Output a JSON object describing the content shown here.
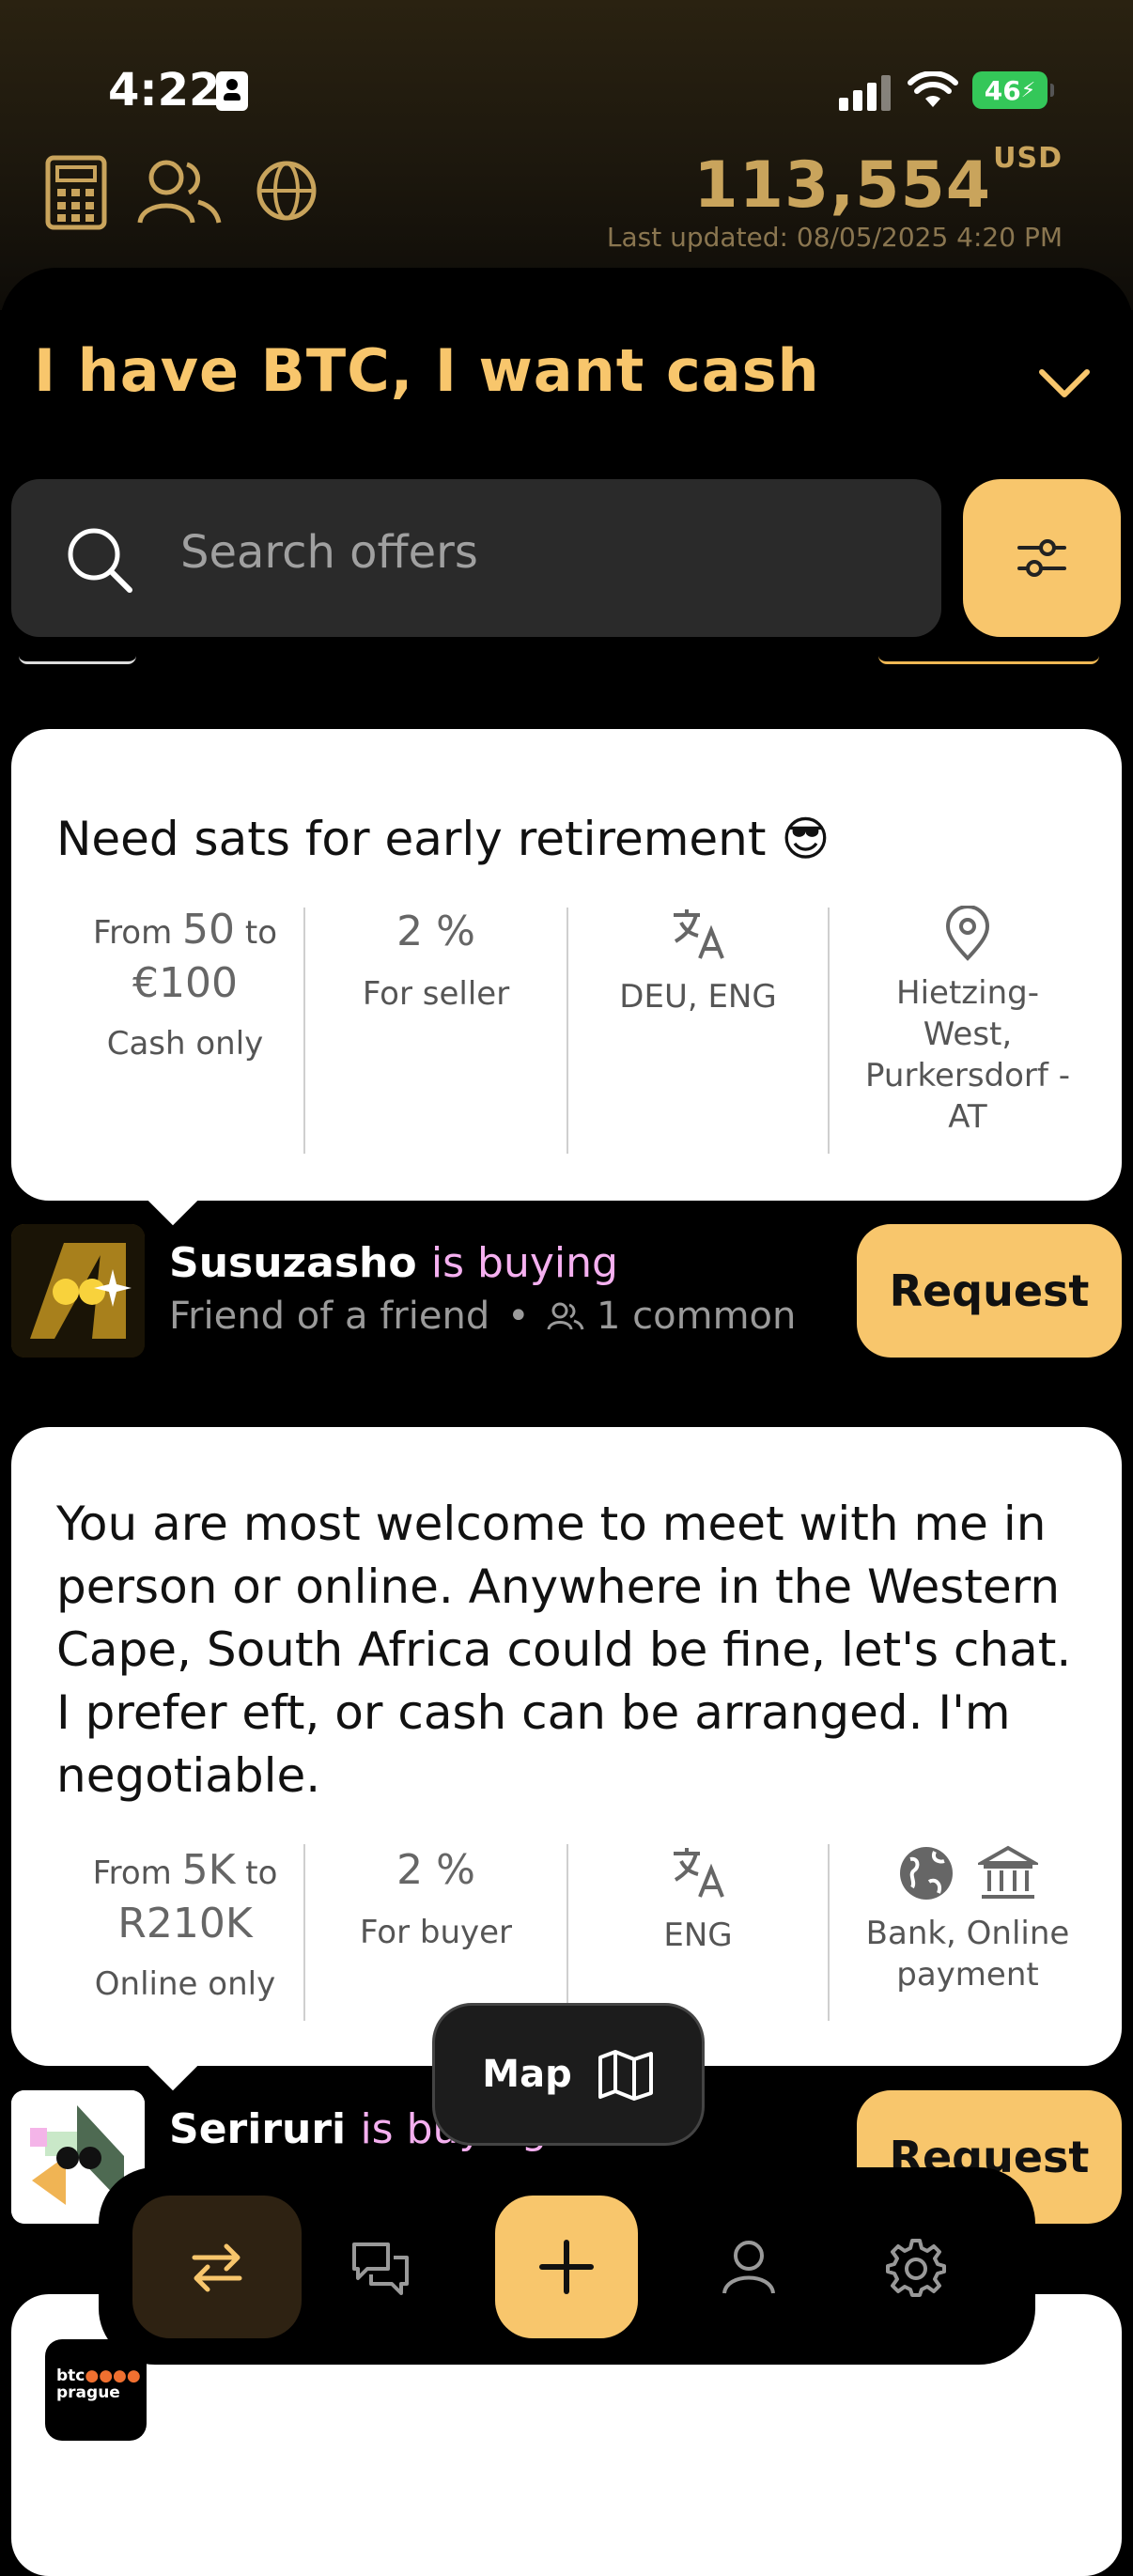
{
  "status_bar": {
    "time": "4:22",
    "battery": "46"
  },
  "header": {
    "price": "113,554",
    "currency": "USD",
    "last_updated": "Last updated: 08/05/2025 4:20 PM",
    "icons": [
      "calculator-icon",
      "users-icon",
      "globe-icon"
    ]
  },
  "title": "I have BTC, I want cash",
  "search": {
    "placeholder": "Search offers"
  },
  "offers": [
    {
      "title": "Need sats for early retirement 😎",
      "amount_from_prefix": "From",
      "amount_from": "50",
      "amount_to_prefix": "to",
      "amount_to": "€100",
      "mode": "Cash only",
      "fee": "2 %",
      "fee_label": "For seller",
      "languages": "DEU, ENG",
      "location": "Hietzing-West, Purkersdorf - AT",
      "user": "Susuzasho",
      "action": "is buying",
      "relation": "Friend of a friend",
      "common": "1 common",
      "button": "Request"
    },
    {
      "title": "You are most welcome to meet with me in person or online. Anywhere in the Western Cape, South Africa could be fine, let's chat. I prefer eft, or cash can be arranged.  I'm negotiable.",
      "amount_from_prefix": "From",
      "amount_from": "5K",
      "amount_to_prefix": "to",
      "amount_to": "R210K",
      "mode": "Online only",
      "fee": "2 %",
      "fee_label": "For buyer",
      "languages": "ENG",
      "payment": "Bank, Online payment",
      "user": "Seriruri",
      "action": "is buying",
      "button": "Request"
    }
  ],
  "map_button": "Map",
  "next_logo": "btc prague",
  "colors": {
    "accent": "#f8c66c",
    "price": "#c9a45c",
    "verb": "#f5b0f0"
  },
  "tabs": [
    "exchange-icon",
    "chat-icon",
    "plus-icon",
    "profile-icon",
    "settings-icon"
  ]
}
